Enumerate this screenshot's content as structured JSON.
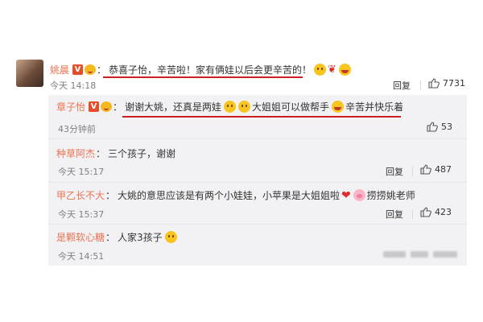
{
  "main_comment": {
    "username": "姚晨",
    "verified_badge": "V",
    "colon": "：",
    "text": "恭喜子怡，辛苦啦！家有俩娃以后会更辛苦的！",
    "emojis": [
      "hug-emoji",
      "rose-emoji",
      "laugh-emoji"
    ],
    "time": "今天 14:18",
    "reply_label": "回复",
    "likes": "7731"
  },
  "replies": [
    {
      "username": "章子怡",
      "verified_badge": "V",
      "colon": "：",
      "text_a": "谢谢大姚，还真是两娃",
      "text_b": "大姐姐可以做帮手",
      "text_c": "辛苦并快乐着",
      "time": "43分钟前",
      "likes": "53"
    },
    {
      "username": "种草阿杰",
      "colon": "：",
      "text": "三个孩子，谢谢",
      "time": "今天 15:17",
      "reply_label": "回复",
      "likes": "487"
    },
    {
      "username": "甲乙长不大",
      "colon": "：",
      "text_a": "大姚的意思应该是有两个小娃娃，小苹果是大姐姐啦",
      "text_b": "捞捞姚老师",
      "time": "今天 15:37",
      "reply_label": "回复",
      "likes": "423"
    },
    {
      "username": "是颗软心糖",
      "colon": "：",
      "text": "人家3孩子",
      "time": "今天 14:51"
    }
  ],
  "colors": {
    "username": "#eb7350",
    "underline": "#cc1f1f",
    "replies_bg": "#f2f2f5"
  }
}
